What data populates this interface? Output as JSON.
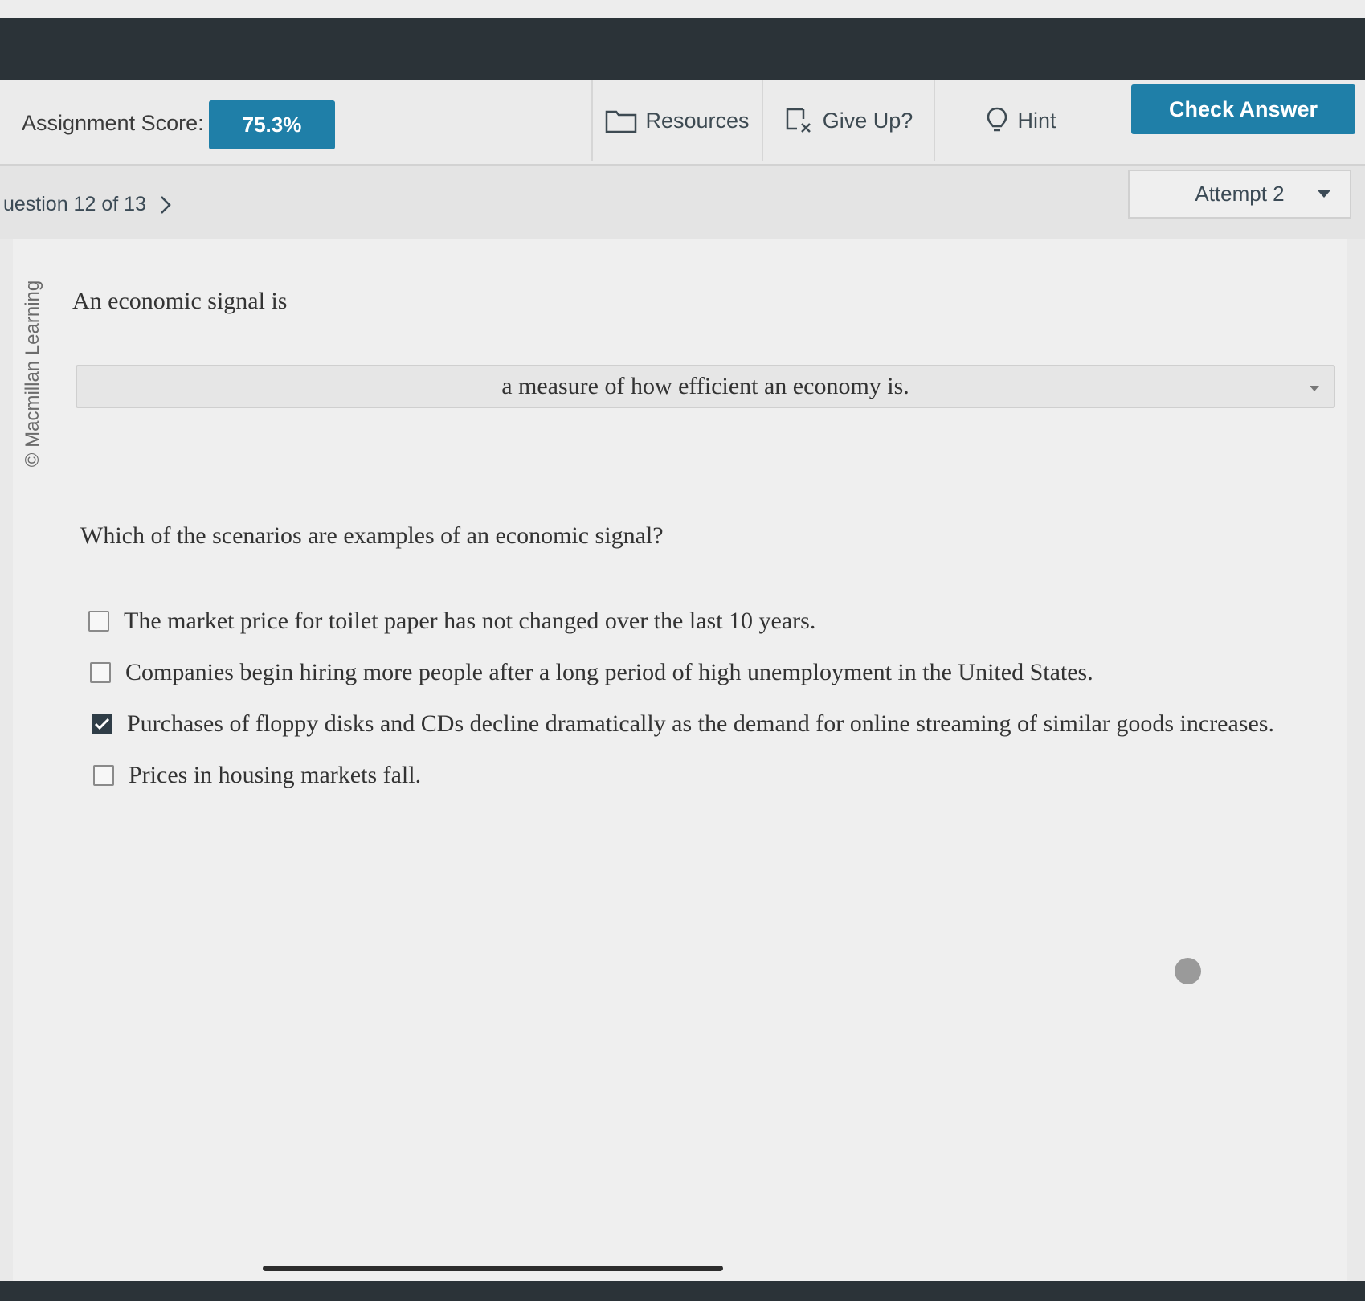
{
  "toolbar": {
    "score_label": "Assignment Score:",
    "score_value": "75.3%",
    "resources_label": "Resources",
    "give_up_label": "Give Up?",
    "hint_label": "Hint",
    "check_answer_label": "Check Answer",
    "icons": [
      "folder-icon",
      "give-up-icon",
      "lightbulb-icon"
    ]
  },
  "nav": {
    "question_label": "uestion 12 of 13",
    "attempt_label": "Attempt 2",
    "icons": [
      "chevron-right-icon",
      "caret-down-icon"
    ]
  },
  "credit": "© Macmillan Learning",
  "question": {
    "stem": "An economic signal is",
    "selected_answer": "a measure of how efficient an economy is.",
    "prompt": "Which of the scenarios are examples of an economic signal?",
    "options": [
      {
        "label": "The market price for toilet paper has not changed over the last 10 years.",
        "checked": false
      },
      {
        "label": "Companies begin hiring more people after a long period of high unemployment in the United States.",
        "checked": false
      },
      {
        "label": "Purchases of floppy disks and CDs decline dramatically as the demand for online streaming of similar goods increases.",
        "checked": true
      },
      {
        "label": "Prices in housing markets fall.",
        "checked": false
      }
    ]
  },
  "colors": {
    "accent": "#1f7fa8",
    "dark_bar": "#2b3338",
    "checkbox_checked": "#2f3d47"
  }
}
